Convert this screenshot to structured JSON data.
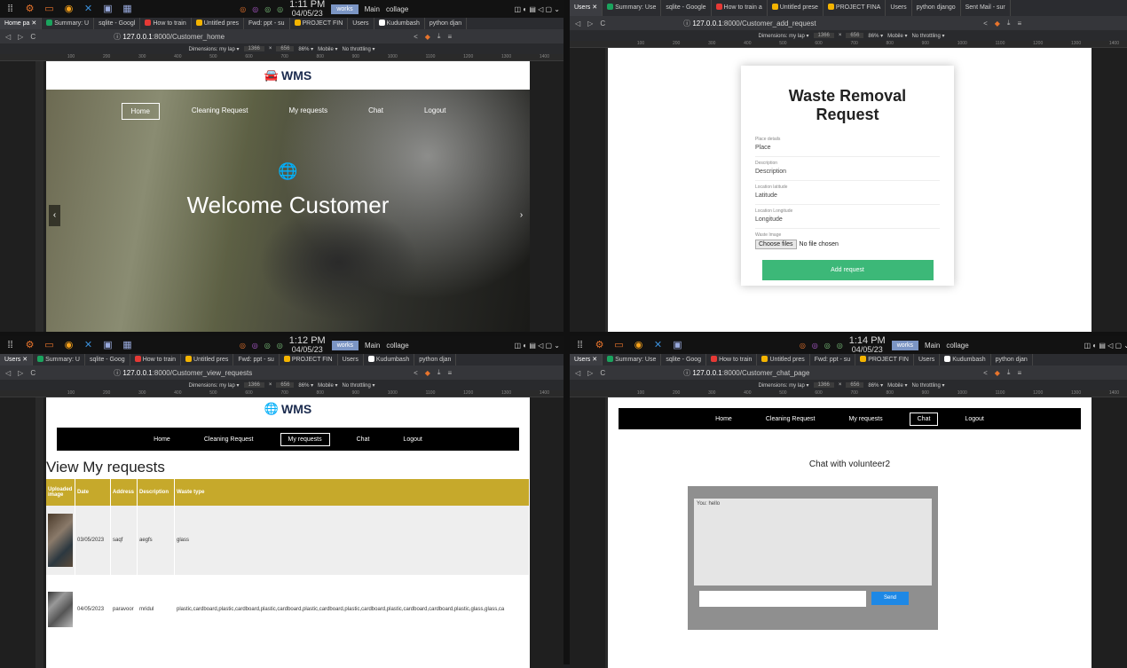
{
  "taskbars": [
    {
      "time": "1:11 PM",
      "date": "04/05/23",
      "ws": "works",
      "main": "Main",
      "collage": "collage"
    },
    {
      "time": "1:12 PM",
      "date": "04/05/23",
      "ws": "works",
      "main": "Main",
      "collage": "collage"
    },
    {
      "time": "1:14 PM",
      "date": "04/05/23",
      "ws": "works",
      "main": "Main",
      "collage": "collage"
    }
  ],
  "q1": {
    "tabs": [
      "Home pa",
      "Summary: U",
      "sqlite - Googl",
      "How to train",
      "Untitled pres",
      "Fwd: ppt - su",
      "PROJECT FIN",
      "Users",
      "Kudumbash",
      "python djan"
    ],
    "url_host": "127.0.0.1",
    "url_path": ":8000/Customer_home",
    "dev": {
      "dims": "Dimensions: my lap ▾",
      "w": "1366",
      "x": "×",
      "h": "656",
      "zoom": "86% ▾",
      "mobile": "Mobile ▾",
      "throttle": "No throttling ▾"
    },
    "logo": "WMS",
    "nav": [
      "Home",
      "Cleaning Request",
      "My requests",
      "Chat",
      "Logout"
    ],
    "hero_title": "Welcome Customer"
  },
  "q2": {
    "tabs": [
      "Users",
      "Summary: Use",
      "sqlite - Google",
      "How to train a",
      "Untitled prese",
      "PROJECT FINA",
      "Users",
      "python django",
      "Sent Mail - sur"
    ],
    "url_host": "127.0.0.1",
    "url_path": ":8000/Customer_add_request",
    "dev": {
      "dims": "Dimensions: my lap ▾",
      "w": "1366",
      "x": "×",
      "h": "656",
      "zoom": "86% ▾",
      "mobile": "Mobile ▾",
      "throttle": "No throttling ▾"
    },
    "form_title": "Waste Removal Request",
    "fields": [
      {
        "label": "Place details",
        "placeholder": "Place"
      },
      {
        "label": "Description",
        "placeholder": "Description"
      },
      {
        "label": "Location latitude",
        "placeholder": "Latitude"
      },
      {
        "label": "Location Longitude",
        "placeholder": "Longitude"
      }
    ],
    "image_label": "Waste Image",
    "choose": "Choose files",
    "nofile": "No file chosen",
    "add_btn": "Add request"
  },
  "q3": {
    "tabs": [
      "Users",
      "Summary: U",
      "sqlite - Goog",
      "How to train",
      "Untitled pres",
      "Fwd: ppt - su",
      "PROJECT FIN",
      "Users",
      "Kudumbash",
      "python djan"
    ],
    "url_host": "127.0.0.1",
    "url_path": ":8000/Customer_view_requests",
    "dev": {
      "dims": "Dimensions: my lap ▾",
      "w": "1366",
      "x": "×",
      "h": "656",
      "zoom": "86% ▾",
      "mobile": "Mobile ▾",
      "throttle": "No throttling ▾"
    },
    "logo": "WMS",
    "nav": [
      "Home",
      "Cleaning Request",
      "My requests",
      "Chat",
      "Logout"
    ],
    "heading": "View My requests",
    "cols": [
      "Uploaded image",
      "Date",
      "Address",
      "Description",
      "Waste type"
    ],
    "rows": [
      {
        "date": "03/05/2023",
        "address": "saqf",
        "desc": "aegfs",
        "type": "glass"
      },
      {
        "date": "04/05/2023",
        "address": "paravoor",
        "desc": "mridul",
        "type": "plastic,cardboard,plastic,cardboard,plastic,cardboard,plastic,cardboard,plastic,cardboard,plastic,cardboard,cardboard,plastic,glass,glass,ca"
      }
    ]
  },
  "q4": {
    "tabs": [
      "Users",
      "Summary: Use",
      "sqlite - Goog",
      "How to train",
      "Untitled pres",
      "Fwd: ppt - su",
      "PROJECT FIN",
      "Users",
      "Kudumbash",
      "python djan"
    ],
    "url_host": "127.0.0.1",
    "url_path": ":8000/Customer_chat_page",
    "dev": {
      "dims": "Dimensions: my lap ▾",
      "w": "1366",
      "x": "×",
      "h": "656",
      "zoom": "86% ▾",
      "mobile": "Mobile ▾",
      "throttle": "No throttling ▾"
    },
    "nav": [
      "Home",
      "Cleaning Request",
      "My requests",
      "Chat",
      "Logout"
    ],
    "chat_title": "Chat with volunteer2",
    "message": "You: hello",
    "send": "Send"
  },
  "ruler": [
    "100",
    "200",
    "300",
    "400",
    "500",
    "600",
    "700",
    "800",
    "900",
    "1000",
    "1100",
    "1200",
    "1300",
    "1400"
  ]
}
